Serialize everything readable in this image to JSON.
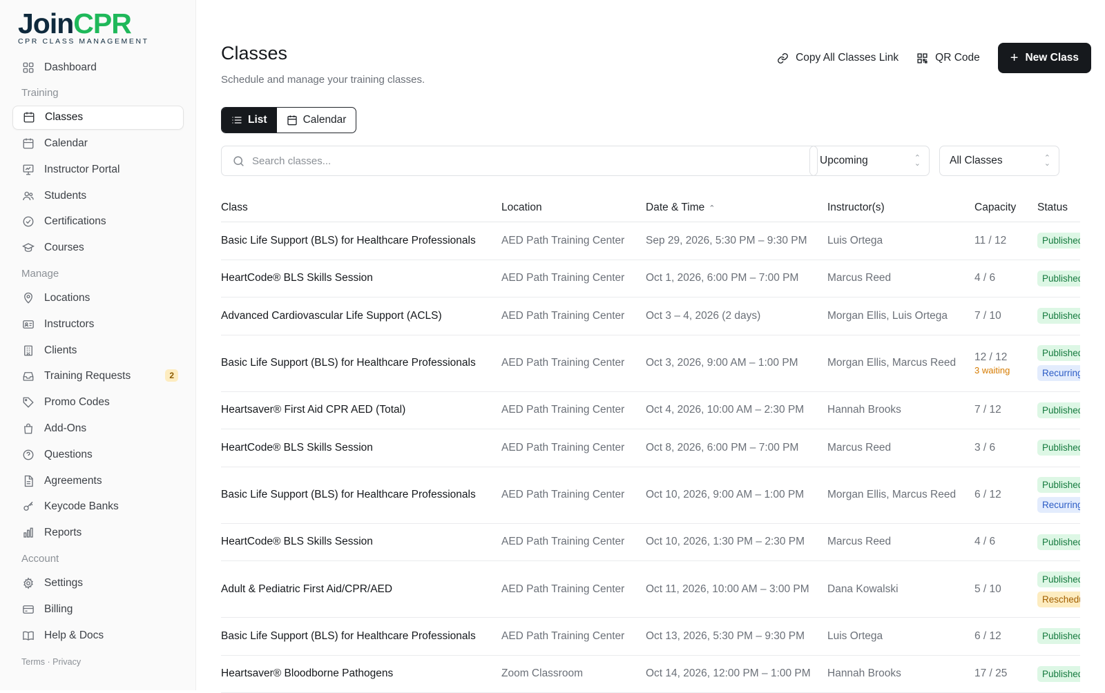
{
  "brand": {
    "join": "Join",
    "cpr": "CPR",
    "tagline": "CPR CLASS MANAGEMENT",
    "join_color": "#0f2a3d",
    "cpr_color": "#1fb85a"
  },
  "sidebar": {
    "items": [
      {
        "type": "item",
        "label": "Dashboard",
        "icon": "dashboard-icon"
      },
      {
        "type": "section",
        "label": "Training"
      },
      {
        "type": "item",
        "label": "Classes",
        "icon": "calendar-icon",
        "active": true
      },
      {
        "type": "item",
        "label": "Calendar",
        "icon": "calendar-icon"
      },
      {
        "type": "item",
        "label": "Instructor Portal",
        "icon": "presentation-icon"
      },
      {
        "type": "item",
        "label": "Students",
        "icon": "users-icon"
      },
      {
        "type": "item",
        "label": "Certifications",
        "icon": "check-circle-icon"
      },
      {
        "type": "item",
        "label": "Courses",
        "icon": "graduation-cap-icon"
      },
      {
        "type": "section",
        "label": "Manage"
      },
      {
        "type": "item",
        "label": "Locations",
        "icon": "map-pin-icon"
      },
      {
        "type": "item",
        "label": "Instructors",
        "icon": "id-card-icon"
      },
      {
        "type": "item",
        "label": "Clients",
        "icon": "building-icon"
      },
      {
        "type": "item",
        "label": "Training Requests",
        "icon": "inbox-icon",
        "badge": "2"
      },
      {
        "type": "item",
        "label": "Promo Codes",
        "icon": "tag-icon"
      },
      {
        "type": "item",
        "label": "Add-Ons",
        "icon": "shopping-bag-icon"
      },
      {
        "type": "item",
        "label": "Questions",
        "icon": "help-circle-icon"
      },
      {
        "type": "item",
        "label": "Agreements",
        "icon": "file-text-icon"
      },
      {
        "type": "item",
        "label": "Keycode Banks",
        "icon": "key-icon"
      },
      {
        "type": "item",
        "label": "Reports",
        "icon": "bar-chart-icon"
      },
      {
        "type": "section",
        "label": "Account"
      },
      {
        "type": "item",
        "label": "Settings",
        "icon": "gear-icon"
      },
      {
        "type": "item",
        "label": "Billing",
        "icon": "credit-card-icon"
      },
      {
        "type": "item",
        "label": "Help & Docs",
        "icon": "book-icon"
      }
    ],
    "footer": "Terms · Privacy"
  },
  "header": {
    "title": "Classes",
    "subtitle": "Schedule and manage your training classes.",
    "copy_link_label": "Copy All Classes Link",
    "qr_label": "QR Code",
    "new_class_label": "New Class"
  },
  "view_toggle": {
    "list_label": "List",
    "calendar_label": "Calendar",
    "active": "List"
  },
  "filters": {
    "search_placeholder": "Search classes...",
    "time_filter": "Upcoming",
    "class_filter": "All Classes"
  },
  "table": {
    "columns": [
      "Class",
      "Location",
      "Date & Time",
      "Instructor(s)",
      "Capacity",
      "Status"
    ],
    "sorted_column": "Date & Time",
    "rows": [
      {
        "class": "Basic Life Support (BLS) for Healthcare Professionals",
        "location": "AED Path Training Center",
        "datetime": "Sep 29, 2026, 5:30 PM – 9:30 PM",
        "instructors": "Luis Ortega",
        "capacity": "11 / 12",
        "statuses": [
          {
            "label": "Published",
            "kind": "pub"
          }
        ]
      },
      {
        "class": "HeartCode® BLS Skills Session",
        "location": "AED Path Training Center",
        "datetime": "Oct 1, 2026, 6:00 PM – 7:00 PM",
        "instructors": "Marcus Reed",
        "capacity": "4 / 6",
        "statuses": [
          {
            "label": "Published",
            "kind": "pub"
          }
        ]
      },
      {
        "class": "Advanced Cardiovascular Life Support (ACLS)",
        "location": "AED Path Training Center",
        "datetime": "Oct 3 – 4, 2026 (2 days)",
        "instructors": "Morgan Ellis, Luis Ortega",
        "capacity": "7 / 10",
        "statuses": [
          {
            "label": "Published",
            "kind": "pub"
          }
        ]
      },
      {
        "class": "Basic Life Support (BLS) for Healthcare Professionals",
        "location": "AED Path Training Center",
        "datetime": "Oct 3, 2026, 9:00 AM – 1:00 PM",
        "instructors": "Morgan Ellis, Marcus Reed",
        "capacity": "12 / 12",
        "waiting": "3 waiting",
        "statuses": [
          {
            "label": "Published",
            "kind": "pub"
          },
          {
            "label": "Recurring",
            "kind": "rec"
          }
        ]
      },
      {
        "class": "Heartsaver® First Aid CPR AED (Total)",
        "location": "AED Path Training Center",
        "datetime": "Oct 4, 2026, 10:00 AM – 2:30 PM",
        "instructors": "Hannah Brooks",
        "capacity": "7 / 12",
        "statuses": [
          {
            "label": "Published",
            "kind": "pub"
          }
        ]
      },
      {
        "class": "HeartCode® BLS Skills Session",
        "location": "AED Path Training Center",
        "datetime": "Oct 8, 2026, 6:00 PM – 7:00 PM",
        "instructors": "Marcus Reed",
        "capacity": "3 / 6",
        "statuses": [
          {
            "label": "Published",
            "kind": "pub"
          }
        ]
      },
      {
        "class": "Basic Life Support (BLS) for Healthcare Professionals",
        "location": "AED Path Training Center",
        "datetime": "Oct 10, 2026, 9:00 AM – 1:00 PM",
        "instructors": "Morgan Ellis, Marcus Reed",
        "capacity": "6 / 12",
        "statuses": [
          {
            "label": "Published",
            "kind": "pub"
          },
          {
            "label": "Recurring",
            "kind": "rec"
          }
        ]
      },
      {
        "class": "HeartCode® BLS Skills Session",
        "location": "AED Path Training Center",
        "datetime": "Oct 10, 2026, 1:30 PM – 2:30 PM",
        "instructors": "Marcus Reed",
        "capacity": "4 / 6",
        "statuses": [
          {
            "label": "Published",
            "kind": "pub"
          }
        ]
      },
      {
        "class": "Adult & Pediatric First Aid/CPR/AED",
        "location": "AED Path Training Center",
        "datetime": "Oct 11, 2026, 10:00 AM – 3:00 PM",
        "instructors": "Dana Kowalski",
        "capacity": "5 / 10",
        "statuses": [
          {
            "label": "Published",
            "kind": "pub"
          },
          {
            "label": "Rescheduled",
            "kind": "res"
          }
        ]
      },
      {
        "class": "Basic Life Support (BLS) for Healthcare Professionals",
        "location": "AED Path Training Center",
        "datetime": "Oct 13, 2026, 5:30 PM – 9:30 PM",
        "instructors": "Luis Ortega",
        "capacity": "6 / 12",
        "statuses": [
          {
            "label": "Published",
            "kind": "pub"
          }
        ]
      },
      {
        "class": "Heartsaver® Bloodborne Pathogens",
        "location": "Zoom Classroom",
        "datetime": "Oct 14, 2026, 12:00 PM – 1:00 PM",
        "instructors": "Hannah Brooks",
        "capacity": "17 / 25",
        "statuses": [
          {
            "label": "Published",
            "kind": "pub"
          }
        ]
      }
    ]
  }
}
